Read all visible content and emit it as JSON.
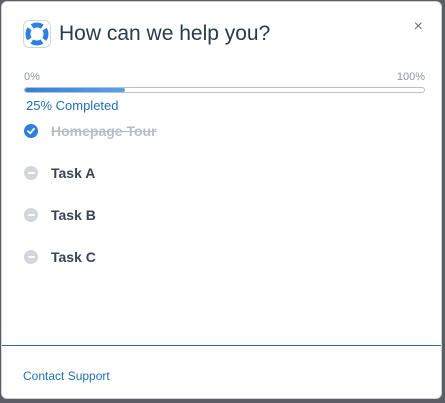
{
  "header": {
    "title": "How can we help you?",
    "close_label": "×"
  },
  "progress": {
    "min_label": "0%",
    "max_label": "100%",
    "value_fraction": 0.25,
    "status_text": "25% Completed"
  },
  "tasks": [
    {
      "label": "Homepage Tour",
      "completed": true
    },
    {
      "label": "Task A",
      "completed": false
    },
    {
      "label": "Task B",
      "completed": false
    },
    {
      "label": "Task C",
      "completed": false
    }
  ],
  "footer": {
    "contact_label": "Contact Support"
  },
  "colors": {
    "accent": "#2f7fdc",
    "link": "#1f6fb2",
    "title": "#2b3a4a"
  }
}
